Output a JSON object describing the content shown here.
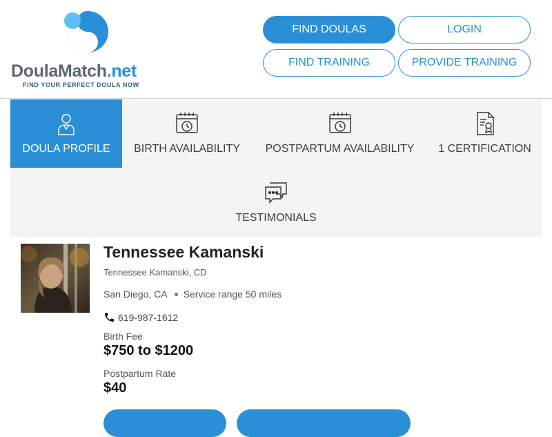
{
  "logo": {
    "name_main": "DoulaMatch",
    "name_suffix": ".net",
    "tagline": "FIND YOUR PERFECT DOULA NOW"
  },
  "nav": {
    "find_doulas": "FIND DOULAS",
    "login": "LOGIN",
    "find_training": "FIND TRAINING",
    "provide_training": "PROVIDE TRAINING"
  },
  "tabs": [
    {
      "label": "DOULA PROFILE",
      "icon": "doula-person-icon",
      "active": true
    },
    {
      "label": "BIRTH AVAILABILITY",
      "icon": "calendar-clock-icon",
      "active": false
    },
    {
      "label": "POSTPARTUM AVAILABILITY",
      "icon": "calendar-clock-icon",
      "active": false
    },
    {
      "label": "1 CERTIFICATION",
      "icon": "certificate-icon",
      "active": false
    },
    {
      "label": "TESTIMONIALS",
      "icon": "chat-bubbles-icon",
      "active": false
    }
  ],
  "profile": {
    "name": "Tennessee Kamanski",
    "credential": "Tennessee Kamanski, CD",
    "location": "San Diego, CA",
    "service_range": "Service range 50 miles",
    "phone": "619-987-1612",
    "birth_fee_label": "Birth Fee",
    "birth_fee_value": "$750 to $1200",
    "postpartum_label": "Postpartum Rate",
    "postpartum_value": "$40"
  },
  "colors": {
    "accent": "#2a8fd6",
    "tab_bg": "#f3f4f5",
    "logo_grey": "#5c6670"
  }
}
